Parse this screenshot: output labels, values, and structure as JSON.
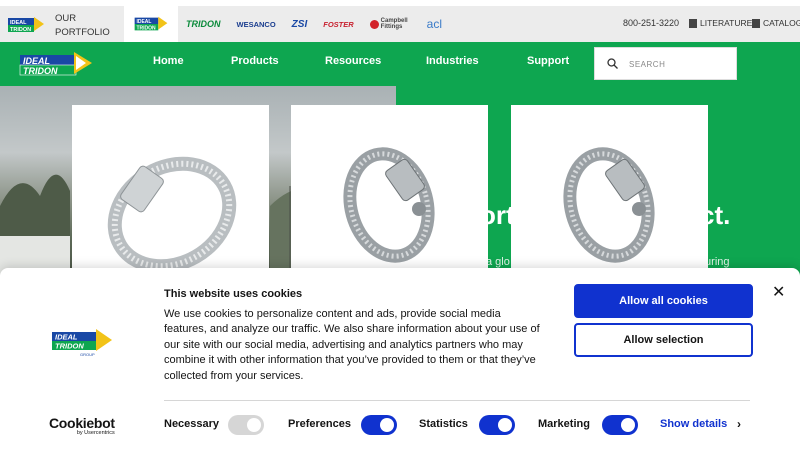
{
  "topbar": {
    "portfolio_label": "OUR PORTFOLIO",
    "brands": [
      "TRIDON",
      "WESANCO",
      "ZSI",
      "FOSTER",
      "Campbell Fittings",
      "acl"
    ],
    "phone": "800-251-3220",
    "literature": "LITERATURE",
    "catalog": "CATALOG"
  },
  "nav": {
    "items": [
      "Home",
      "Products",
      "Resources",
      "Industries",
      "Support"
    ],
    "search_placeholder": "SEARCH"
  },
  "hero": {
    "headline_left": "orti",
    "headline_right": "ct.",
    "sub_left": "a glo",
    "sub_right": "turing"
  },
  "cookie": {
    "title": "This website uses cookies",
    "body": "We use cookies to personalize content and ads, provide social media features, and analyze our traffic. We also share information about your use of our site with our social media, advertising and analytics partners who may combine it with other information that you’ve provided to them or that they’ve collected from your services.",
    "allow_all": "Allow all cookies",
    "allow_selection": "Allow selection",
    "close": "✕",
    "options": [
      {
        "label": "Necessary",
        "enabled": true,
        "locked": true
      },
      {
        "label": "Preferences",
        "enabled": true
      },
      {
        "label": "Statistics",
        "enabled": true
      },
      {
        "label": "Marketing",
        "enabled": true
      }
    ],
    "show_details": "Show details",
    "chevron": "›",
    "cookiebot_name": "Cookiebot",
    "cookiebot_by": "by Usercentrics"
  },
  "colors": {
    "brand_green": "#0ea650",
    "cookie_blue": "#1032cf"
  }
}
